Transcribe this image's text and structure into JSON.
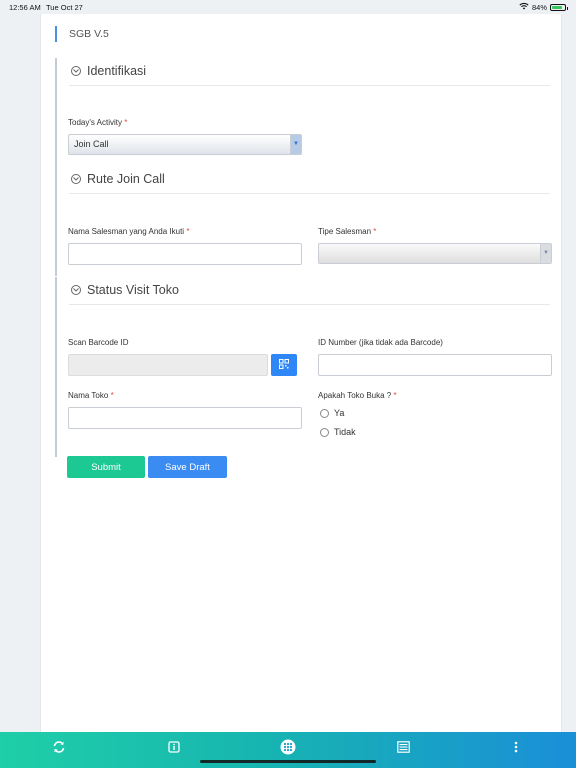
{
  "status_bar": {
    "time": "12:56 AM",
    "date": "Tue Oct 27",
    "battery": "84%",
    "battery_level": 0.84
  },
  "app": {
    "title": "SGB V.5"
  },
  "sections": {
    "identifikasi": {
      "title": "Identifikasi",
      "todays_activity_label": "Today's Activity",
      "todays_activity_value": "Join Call"
    },
    "rute": {
      "title": "Rute Join Call",
      "nama_salesman_label": "Nama Salesman yang Anda Ikuti",
      "nama_salesman_value": "",
      "tipe_salesman_label": "Tipe Salesman",
      "tipe_salesman_value": ""
    },
    "status_visit": {
      "title": "Status Visit Toko",
      "scan_barcode_label": "Scan Barcode ID",
      "scan_barcode_value": "",
      "id_number_label": "ID Number (jika tidak ada Barcode)",
      "id_number_value": "",
      "nama_toko_label": "Nama Toko",
      "nama_toko_value": "",
      "toko_buka_label": "Apakah Toko Buka ?",
      "toko_buka_options": [
        "Ya",
        "Tidak"
      ]
    }
  },
  "required_mark": "*",
  "actions": {
    "submit": "Submit",
    "save_draft": "Save Draft"
  },
  "tab_bar": {
    "icons": [
      "refresh-icon",
      "info-icon",
      "grid-menu-icon",
      "list-icon",
      "more-vertical-icon"
    ],
    "colors": {
      "start": "#1fcfa8",
      "end": "#1a8fd8"
    }
  },
  "colors": {
    "submit": "#1cc993",
    "save_draft": "#3a8cf2",
    "qr_button": "#2f86f6",
    "required": "#e04848"
  }
}
